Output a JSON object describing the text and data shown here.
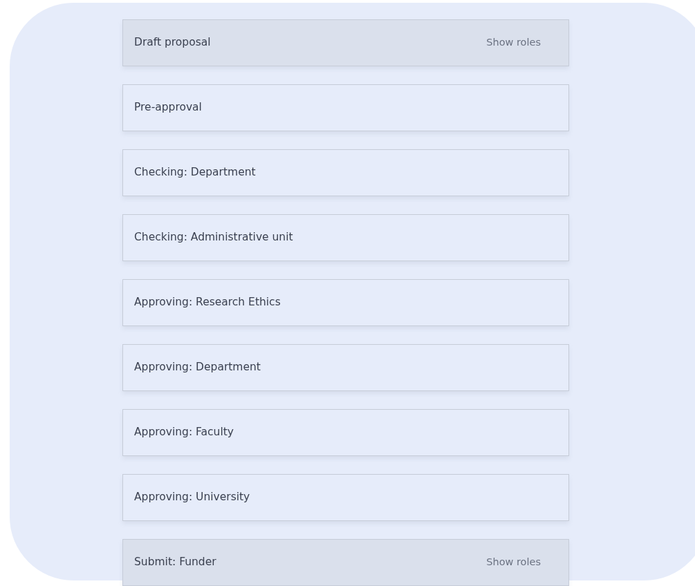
{
  "steps": [
    {
      "label": "Draft proposal",
      "highlighted": true,
      "action": "Show roles"
    },
    {
      "label": "Pre-approval",
      "highlighted": false
    },
    {
      "label": "Checking: Department",
      "highlighted": false
    },
    {
      "label": "Checking: Administrative unit",
      "highlighted": false
    },
    {
      "label": "Approving: Research Ethics",
      "highlighted": false
    },
    {
      "label": "Approving: Department",
      "highlighted": false
    },
    {
      "label": "Approving: Faculty",
      "highlighted": false
    },
    {
      "label": "Approving: University",
      "highlighted": false
    },
    {
      "label": "Submit: Funder",
      "highlighted": true,
      "action": "Show roles"
    }
  ]
}
